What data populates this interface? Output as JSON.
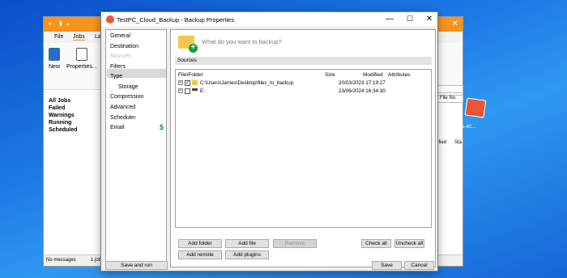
{
  "background_app": {
    "ribbon_tabs": [
      "File",
      "Jobs",
      "Lay"
    ],
    "ribbon_buttons": [
      "New",
      "Properties..."
    ],
    "sidebar": [
      "All Jobs",
      "Failed",
      "Warnings",
      "Running",
      "Scheduled"
    ],
    "status_left": "No messages",
    "status_right": "1 jobs",
    "right_col_header": "File No.",
    "right_col_labels": [
      "ified",
      "Sta"
    ]
  },
  "desktop_icon_label": "s-40...",
  "dialog": {
    "title": "TestPC_Cloud_Backup - Backup Properties",
    "nav": [
      "General",
      "Destination",
      "Sources",
      "Filters",
      "Type",
      "Storage",
      "Compression",
      "Advanced",
      "Scheduler",
      "Email"
    ],
    "nav_badge": "$",
    "save_and_run": "Save and run",
    "question": "What do you want to backup?",
    "sources_header": "Sources",
    "columns": {
      "file_folder": "File\\Folder",
      "size": "Size",
      "modified": "Modified",
      "attributes": "Attributes"
    },
    "rows": [
      {
        "path": "C:\\Users\\James\\Desktop\\files_to_backup",
        "modified": "20/03/2023 17:19:27",
        "checked": "✓"
      },
      {
        "path": "E:",
        "modified": "23/06/2024 16:34:30",
        "checked": ""
      }
    ],
    "buttons": {
      "add_folder": "Add folder",
      "add_file": "Add file",
      "remove": "Remove",
      "check_all": "Check all",
      "uncheck_all": "Uncheck all",
      "add_remote": "Add remote",
      "add_plugins": "Add plugins",
      "save": "Save",
      "cancel": "Cancel"
    },
    "window_controls": {
      "minimize": "—",
      "maximize": "☐",
      "close": "✕"
    }
  }
}
